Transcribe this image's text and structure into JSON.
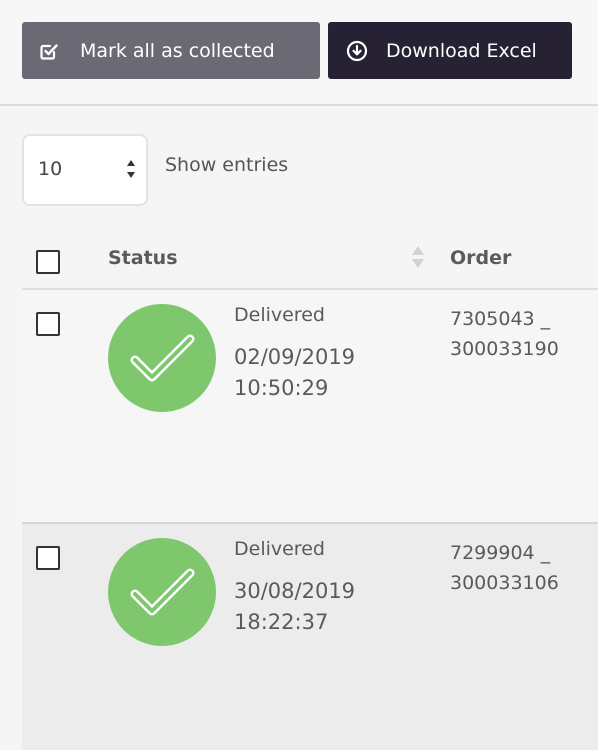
{
  "toolbar": {
    "mark_label": "Mark all as collected",
    "mark_icon": "checkbox-check-icon",
    "download_label": "Download Excel",
    "download_icon": "download-circle-icon"
  },
  "entries": {
    "selected_value": "10",
    "label": "Show entries"
  },
  "table": {
    "columns": [
      "Status",
      "Order"
    ],
    "rows": [
      {
        "status": "Delivered",
        "date": "02/09/2019",
        "time": "10:50:29",
        "order_line1": "7305043 _",
        "order_line2": "300033190",
        "checked": false
      },
      {
        "status": "Delivered",
        "date": "30/08/2019",
        "time": "18:22:37",
        "order_line1": "7299904 _",
        "order_line2": "300033106",
        "checked": false
      }
    ]
  },
  "colors": {
    "mark_button": "#6b6973",
    "download_button": "#262233",
    "delivered_green": "#7ec76d"
  }
}
